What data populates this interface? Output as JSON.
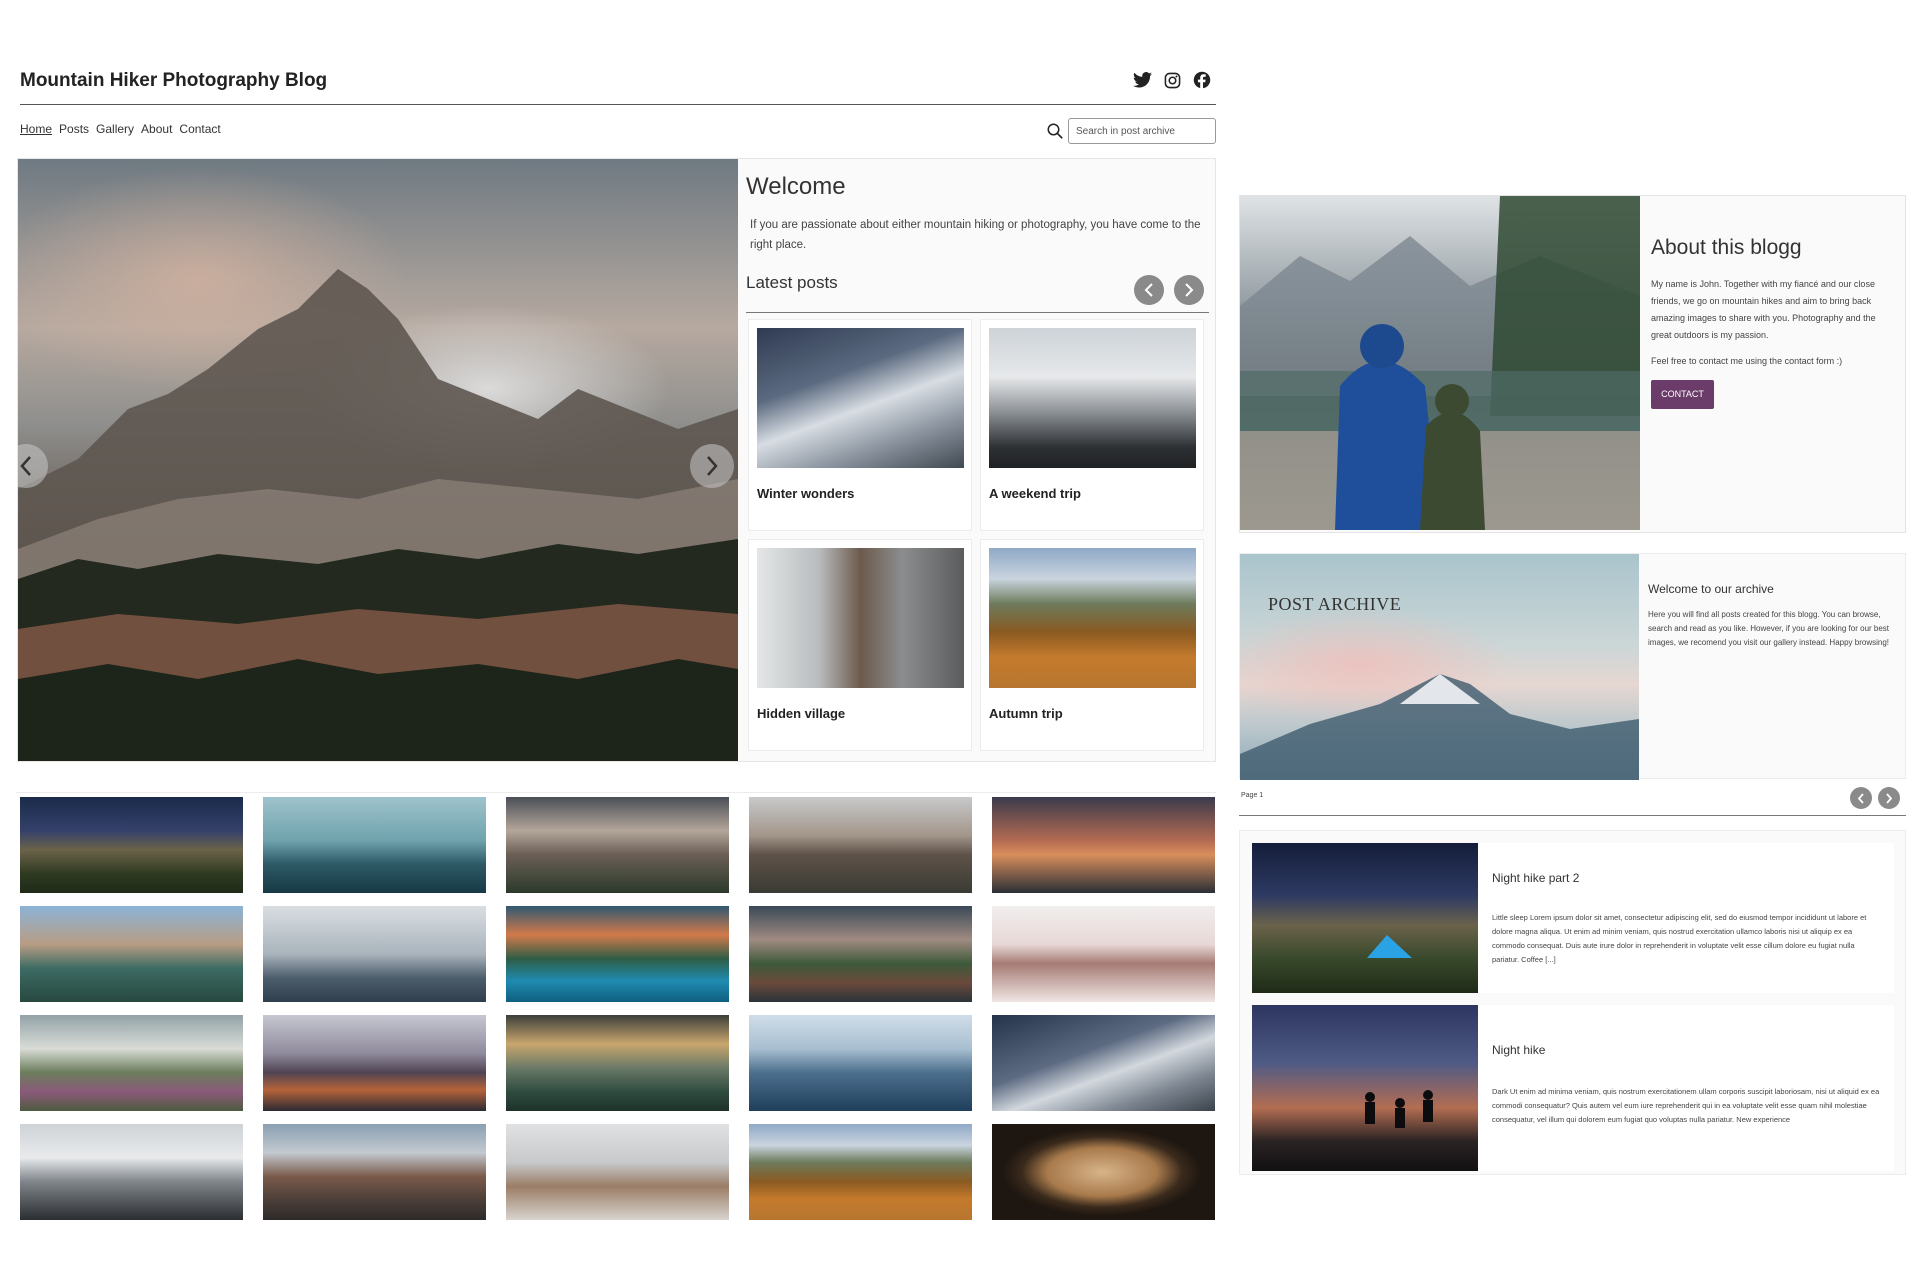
{
  "header": {
    "site_title": "Mountain Hiker Photography Blog",
    "social_icons": [
      "twitter-icon",
      "instagram-icon",
      "facebook-icon"
    ]
  },
  "nav": {
    "items": [
      "Home",
      "Posts",
      "Gallery",
      "About",
      "Contact"
    ],
    "active": "Home"
  },
  "search": {
    "placeholder": "Search in post archive",
    "icon": "search-icon"
  },
  "welcome": {
    "title": "Welcome",
    "text": "If you are passionate about either mountain hiking or photography, you have come to the right place."
  },
  "latest": {
    "title": "Latest posts",
    "posts": [
      {
        "title": "Winter wonders"
      },
      {
        "title": "A weekend trip"
      },
      {
        "title": "Hidden village"
      },
      {
        "title": "Autumn trip"
      }
    ]
  },
  "about": {
    "title": "About this blogg",
    "text": "My name is John. Together with my fiancé and our close friends, we go on mountain hikes and aim to bring back amazing images to share with you. Photography and the great outdoors is my passion.",
    "text2": "Feel free to contact me using the contact form :)",
    "button_label": "CONTACT"
  },
  "archive": {
    "image_label": "POST ARCHIVE",
    "title": "Welcome to our archive",
    "text": "Here you will find all posts created for this blogg. You can browse, search and read as you like. However, if you are looking for our best images, we recomend you visit our gallery instead. Happy browsing!",
    "page_label": "Page 1",
    "posts": [
      {
        "title": "Night hike part 2",
        "text": "Little sleep Lorem ipsum dolor sit amet, consectetur adipiscing elit, sed do eiusmod tempor incididunt ut labore et dolore magna aliqua. Ut enim ad minim veniam, quis nostrud exercitation ullamco laboris nisi ut aliquip ex ea commodo consequat. Duis aute irure dolor in reprehenderit in voluptate velit esse cillum dolore eu fugiat nulla pariatur. Coffee [...]"
      },
      {
        "title": "Night hike",
        "text": "Dark Ut enim ad minima veniam, quis nostrum exercitationem ullam corporis suscipit laboriosam, nisi ut aliquid ex ea commodi consequatur? Quis autem vel eum iure reprehenderit qui in ea voluptate velit esse quam nihil molestiae consequatur, vel illum qui dolorem eum fugiat quo voluptas nulla pariatur. New experience"
      }
    ]
  },
  "colors": {
    "accent": "#6b3b6a",
    "round_button": "#8a8a8a"
  }
}
